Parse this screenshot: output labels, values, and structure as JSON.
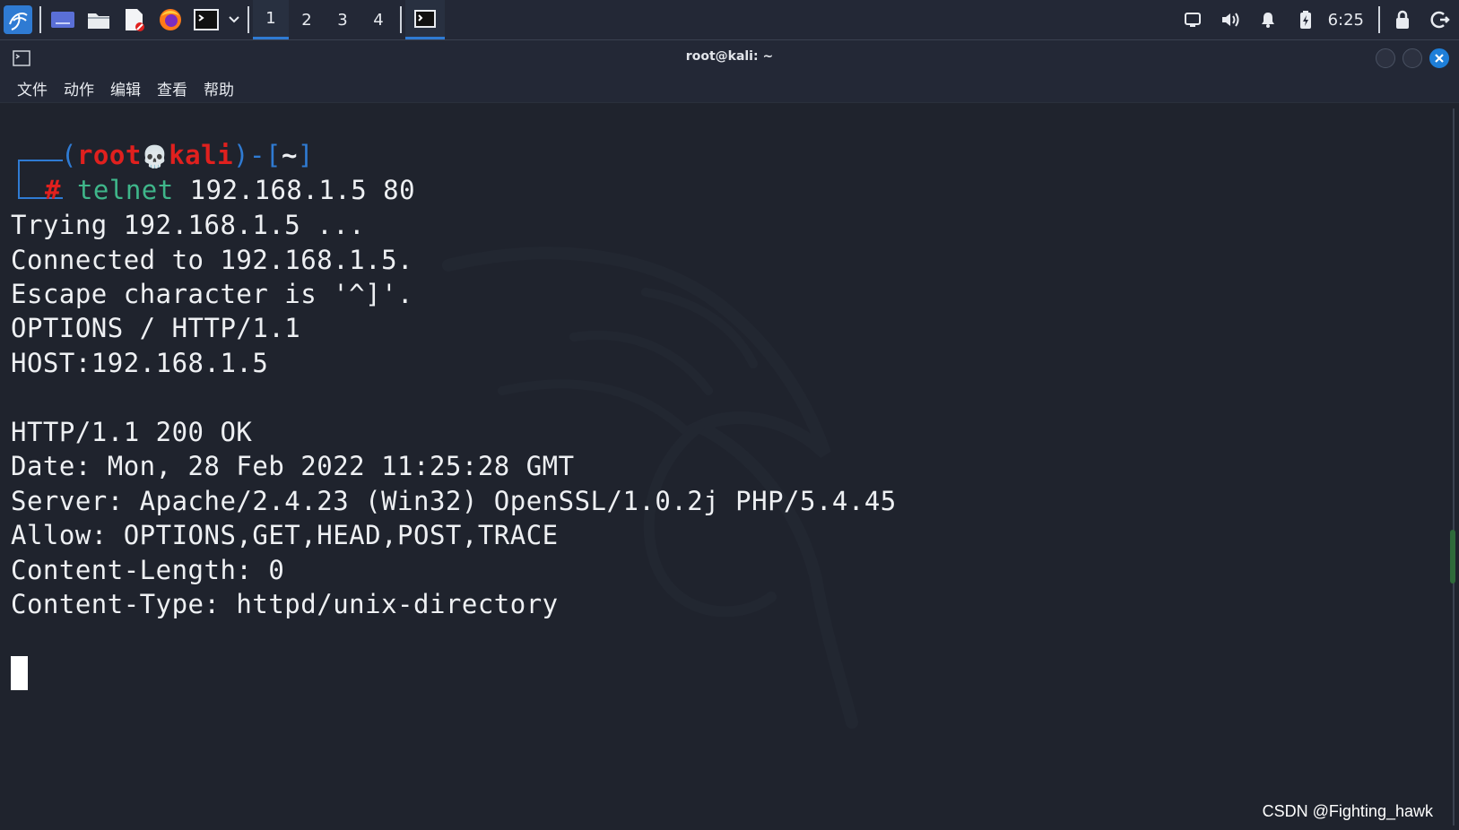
{
  "taskbar": {
    "workspaces": [
      "1",
      "2",
      "3",
      "4"
    ],
    "active_workspace": "1",
    "clock": "6:25"
  },
  "window": {
    "title": "root@kali: ~"
  },
  "menu": {
    "file": "文件",
    "action": "动作",
    "edit": "编辑",
    "view": "查看",
    "help": "帮助"
  },
  "terminal": {
    "prompt": {
      "open_paren": "(",
      "user": "root",
      "skull": "💀",
      "host": "kali",
      "mid": ")-[",
      "dir": "~",
      "close": "]",
      "hash": "#",
      "command": "telnet",
      "args": " 192.168.1.5 80"
    },
    "lines": [
      "Trying 192.168.1.5 ...",
      "Connected to 192.168.1.5.",
      "Escape character is '^]'.",
      "OPTIONS / HTTP/1.1",
      "HOST:192.168.1.5",
      "",
      "HTTP/1.1 200 OK",
      "Date: Mon, 28 Feb 2022 11:25:28 GMT",
      "Server: Apache/2.4.23 (Win32) OpenSSL/1.0.2j PHP/5.4.45",
      "Allow: OPTIONS,GET,HEAD,POST,TRACE",
      "Content-Length: 0",
      "Content-Type: httpd/unix-directory"
    ]
  },
  "watermark": "CSDN @Fighting_hawk",
  "colors": {
    "accent": "#2f7bd3",
    "prompt_red": "#e0201e",
    "command_green": "#3fb68a",
    "background": "#1f232d"
  }
}
